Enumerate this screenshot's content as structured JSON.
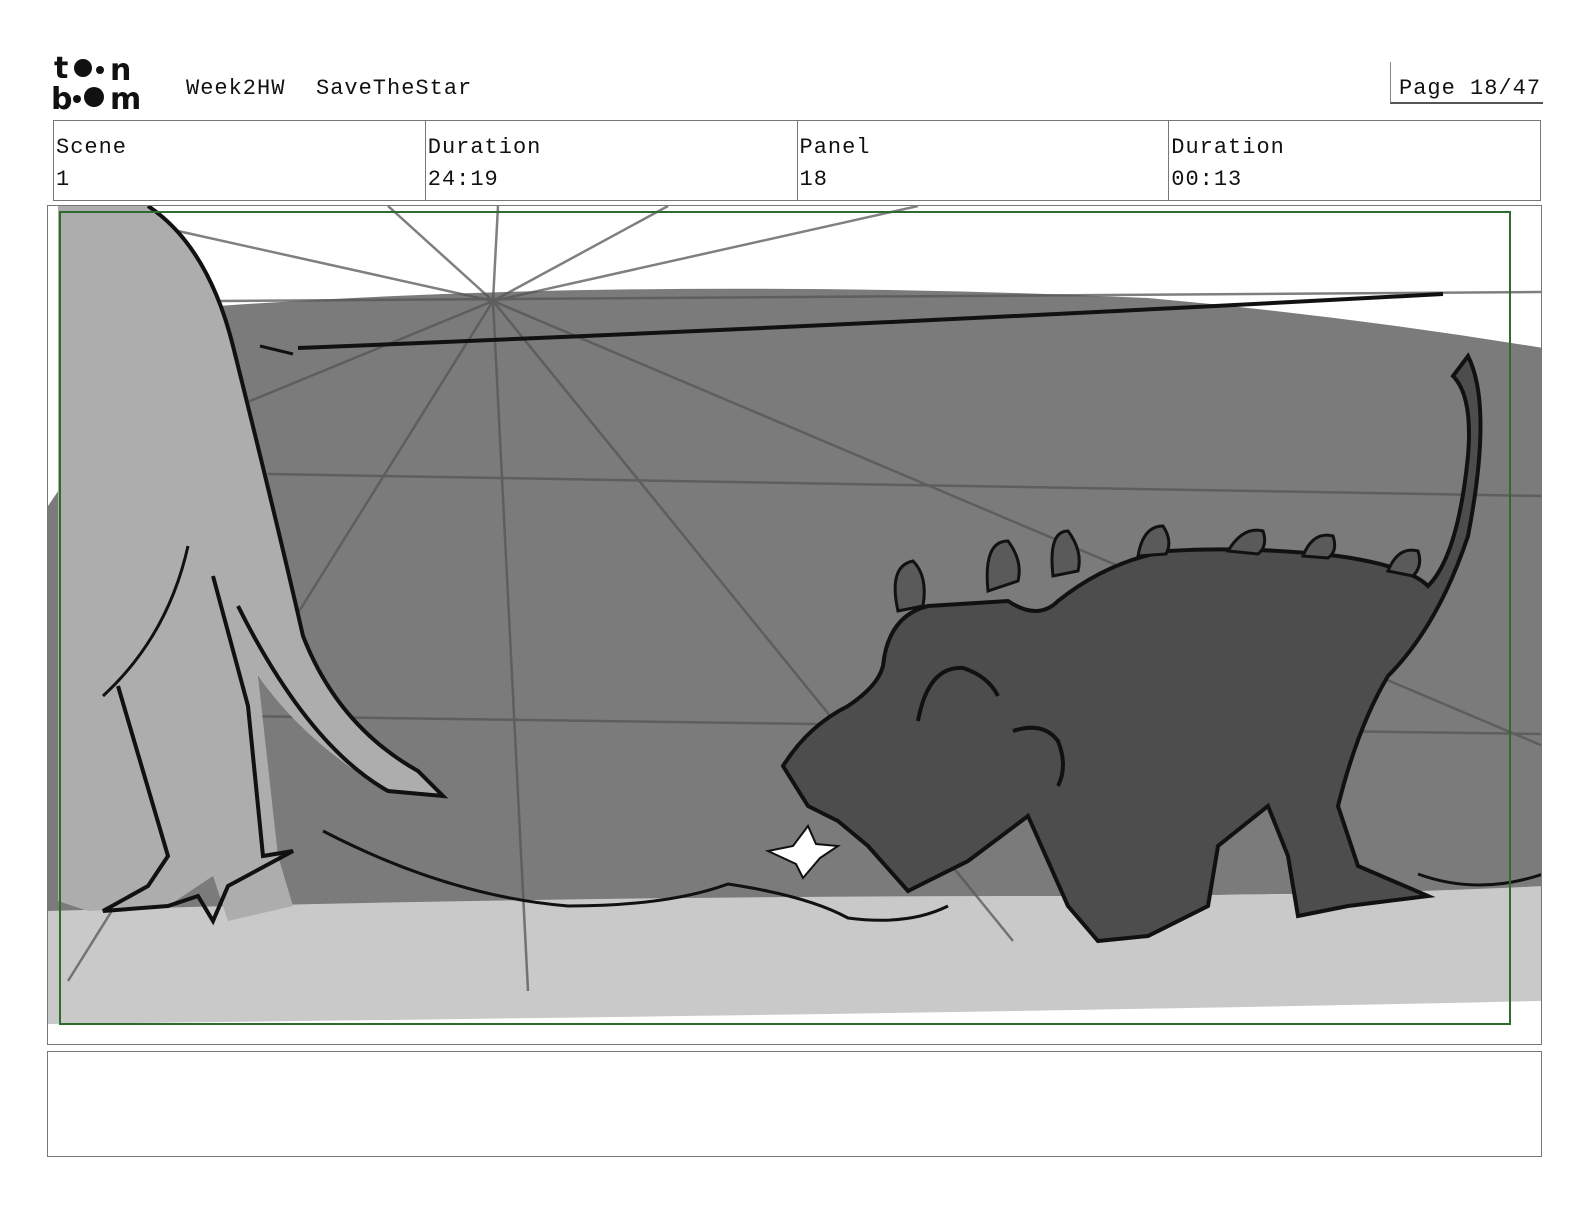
{
  "header": {
    "logo_text": "toon boom",
    "project": "Week2HW",
    "sheet_name": "SaveTheStar",
    "page": "Page 18/47"
  },
  "info": {
    "scene_label": "Scene",
    "scene_value": "1",
    "duration_label": "Duration",
    "duration_value": "24:19",
    "panel_label": "Panel",
    "panel_value": "18",
    "panel_duration_label": "Duration",
    "panel_duration_value": "00:13"
  },
  "panel_image": {
    "safe_frame_color": "#2e6b2e",
    "floor_color": "#c9c9c9",
    "wall_color": "#7b7b7b",
    "dino_left_color": "#adadad",
    "dino_right_color": "#4d4d4d"
  },
  "notes": {
    "text": ""
  }
}
